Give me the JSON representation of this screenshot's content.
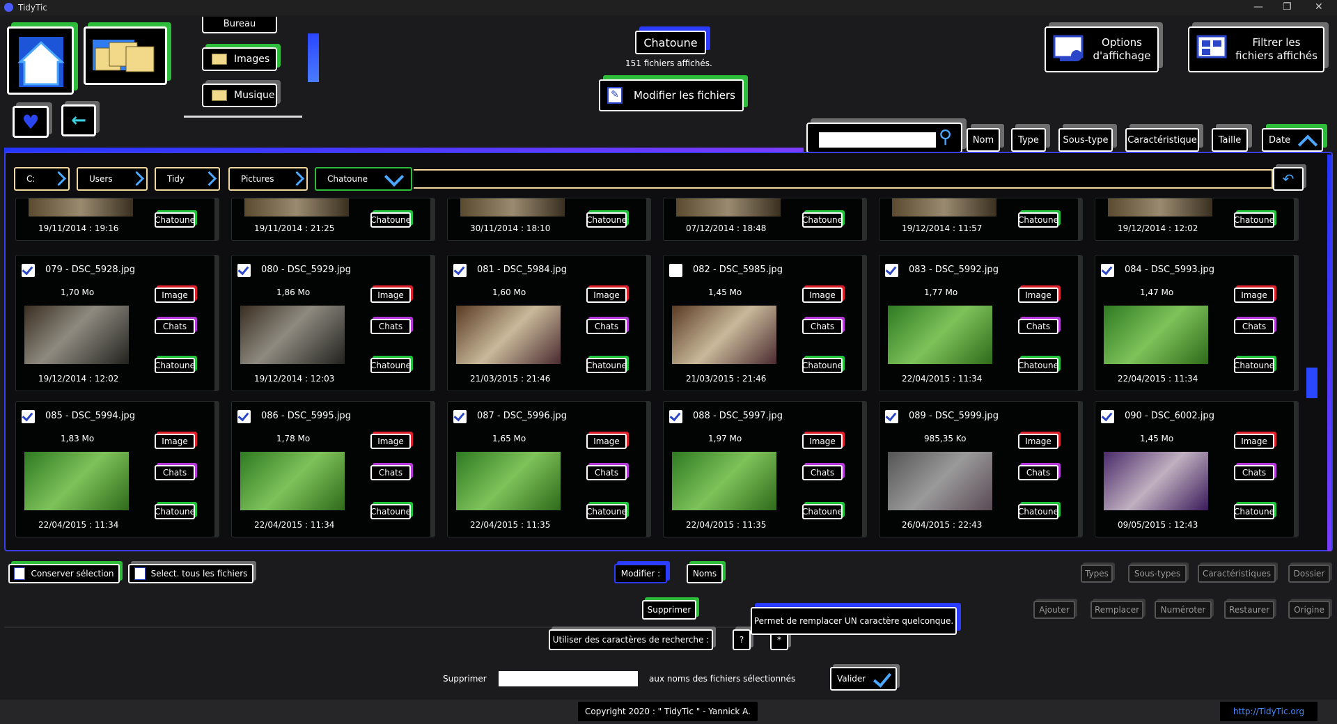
{
  "window": {
    "title": "TidyTic"
  },
  "header": {
    "folder_name": "Chatoune",
    "file_count_label": "151 fichiers affichés.",
    "modify_files_label": "Modifier les fichiers",
    "display_options_label_1": "Options",
    "display_options_label_2": "d'affichage",
    "filter_label_1": "Filtrer les",
    "filter_label_2": "fichiers affichés",
    "quick_folders": [
      "Bureau",
      "Images",
      "Musique"
    ]
  },
  "search": {
    "value": "",
    "placeholder": ""
  },
  "sort_buttons": [
    "Nom",
    "Type",
    "Sous-type",
    "Caractéristique",
    "Taille",
    "Date"
  ],
  "breadcrumb": [
    "C:",
    "Users",
    "Tidy",
    "Pictures",
    "Chatoune"
  ],
  "top_row_dates": [
    "19/11/2014 : 19:16",
    "19/11/2014 : 21:25",
    "30/11/2014 : 18:10",
    "07/12/2014 : 18:48",
    "19/12/2014 : 11:57",
    "19/12/2014 : 12:02"
  ],
  "tag_labels": {
    "type": "Image",
    "subtype": "Chats",
    "feature": "Chatoune"
  },
  "files": [
    {
      "name": "079 - DSC_5928.jpg",
      "size": "1,70 Mo",
      "date": "19/12/2014 : 12:02",
      "checked": true,
      "thumb": "dark"
    },
    {
      "name": "080 - DSC_5929.jpg",
      "size": "1,86 Mo",
      "date": "19/12/2014 : 12:03",
      "checked": true,
      "thumb": "dark"
    },
    {
      "name": "081 - DSC_5984.jpg",
      "size": "1,60 Mo",
      "date": "21/03/2015 : 21:46",
      "checked": true,
      "thumb": "warm"
    },
    {
      "name": "082 - DSC_5985.jpg",
      "size": "1,45 Mo",
      "date": "21/03/2015 : 21:46",
      "checked": false,
      "thumb": "warm"
    },
    {
      "name": "083 - DSC_5992.jpg",
      "size": "1,77 Mo",
      "date": "22/04/2015 : 11:34",
      "checked": true,
      "thumb": "green"
    },
    {
      "name": "084 - DSC_5993.jpg",
      "size": "1,47 Mo",
      "date": "22/04/2015 : 11:34",
      "checked": true,
      "thumb": "green"
    },
    {
      "name": "085 - DSC_5994.jpg",
      "size": "1,83 Mo",
      "date": "22/04/2015 : 11:34",
      "checked": true,
      "thumb": "green"
    },
    {
      "name": "086 - DSC_5995.jpg",
      "size": "1,78 Mo",
      "date": "22/04/2015 : 11:34",
      "checked": true,
      "thumb": "green"
    },
    {
      "name": "087 - DSC_5996.jpg",
      "size": "1,65 Mo",
      "date": "22/04/2015 : 11:35",
      "checked": true,
      "thumb": "green"
    },
    {
      "name": "088 - DSC_5997.jpg",
      "size": "1,97 Mo",
      "date": "22/04/2015 : 11:35",
      "checked": true,
      "thumb": "green"
    },
    {
      "name": "089 - DSC_5999.jpg",
      "size": "985,35 Ko",
      "date": "26/04/2015 : 22:43",
      "checked": true,
      "thumb": "gray"
    },
    {
      "name": "090 - DSC_6002.jpg",
      "size": "1,45 Mo",
      "date": "09/05/2015 : 12:43",
      "checked": true,
      "thumb": "purple"
    }
  ],
  "bottom": {
    "keep_selection": "Conserver sélection",
    "select_all": "Select. tous les fichiers",
    "modify": "Modifier :",
    "names": "Noms",
    "types": "Types",
    "subtypes": "Sous-types",
    "features": "Caractéristiques",
    "folder": "Dossier",
    "delete": "Supprimer",
    "add": "Ajouter",
    "replace": "Remplacer",
    "number": "Numéroter",
    "restore": "Restaurer",
    "origin": "Origine",
    "use_search_chars": "Utiliser des caractères de recherche :",
    "q_char": "?",
    "star_char": "*",
    "tooltip": "Permet de remplacer UN caractère quelconque.",
    "remove_label": "Supprimer",
    "remove_value": "",
    "remove_suffix": "aux noms des fichiers sélectionnés",
    "validate": "Valider"
  },
  "footer": {
    "copyright": "Copyright 2020 : \" TidyTic \" - Yannick A.",
    "link": "http://TidyTic.org"
  },
  "colors": {
    "accent_blue": "#2b3cff",
    "accent_green": "#21c43a",
    "tag_red": "#e0202a",
    "tag_purple": "#b638d8"
  }
}
